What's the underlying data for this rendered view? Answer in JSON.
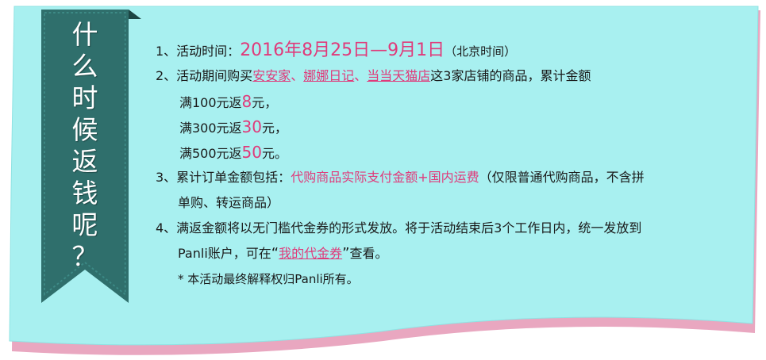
{
  "ribbon": {
    "chars": [
      "什",
      "么",
      "时",
      "候",
      "返",
      "钱",
      "呢",
      "？"
    ]
  },
  "item1": {
    "prefix": "1、活动时间：",
    "dates": "2016年8月25日—9月1日",
    "suffix": "（北京时间）"
  },
  "item2": {
    "prefix": "2、活动期间购买",
    "store1": "安安家",
    "sep1": "、",
    "store2": "娜娜日记",
    "sep2": "、",
    "store3": "当当天猫店",
    "suffix": "这3家店铺的商品，累计金额",
    "tiers": [
      {
        "before": "满100元返",
        "amount": "8",
        "after": "元，"
      },
      {
        "before": "满300元返",
        "amount": "30",
        "after": "元，"
      },
      {
        "before": "满500元返",
        "amount": "50",
        "after": "元。"
      }
    ]
  },
  "item3": {
    "prefix": "3、累计订单金额包括：",
    "highlight": "代购商品实际支付金额+国内运费",
    "suffix": "（仅限普通代购商品，不含拼",
    "line2": "单购、转运商品）"
  },
  "item4": {
    "line1": "4、满返金额将以无门槛代金券的形式发放。将于活动结束后3个工作日内，统一发放到",
    "line2_prefix": "Panli账户，可在",
    "open_quote": "“",
    "link": "我的代金券",
    "close_quote": "”",
    "line2_suffix": "查看。"
  },
  "note": "* 本活动最终解释权归Panli所有。",
  "colors": {
    "card": "#a8f0f0",
    "ribbon": "#2f6f6c",
    "ribbon_fold": "#1c4644",
    "accent": "#e03a7a",
    "bottom_edge": "#e9a7c0"
  }
}
